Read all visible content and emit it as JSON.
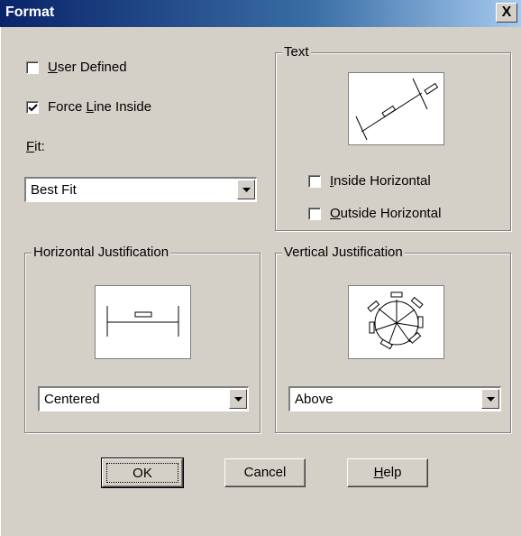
{
  "window": {
    "title": "Format",
    "close_glyph": "X"
  },
  "options": {
    "user_defined": {
      "prefix": "",
      "accel": "U",
      "rest": "ser Defined",
      "checked": false
    },
    "force_line_inside": {
      "prefix": "Force ",
      "accel": "L",
      "rest": "ine Inside",
      "checked": true
    }
  },
  "fit": {
    "label_accel": "F",
    "label_rest": "it:",
    "value": "Best Fit"
  },
  "text_group": {
    "title": "Text",
    "inside_horizontal": {
      "accel": "I",
      "rest": "nside Horizontal",
      "checked": false
    },
    "outside_horizontal": {
      "accel": "O",
      "rest": "utside Horizontal",
      "checked": false
    }
  },
  "horizontal_justification": {
    "title": "Horizontal Justification",
    "value": "Centered"
  },
  "vertical_justification": {
    "title": "Vertical Justification",
    "value": "Above"
  },
  "buttons": {
    "ok": "OK",
    "cancel": "Cancel",
    "help_accel": "H",
    "help_rest": "elp"
  }
}
